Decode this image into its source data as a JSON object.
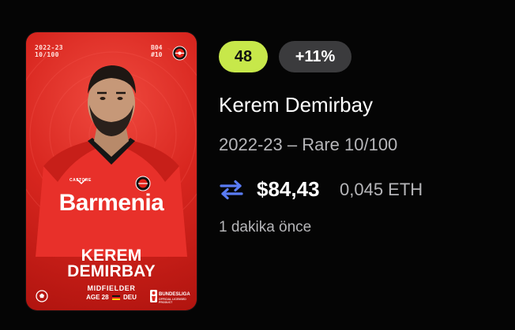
{
  "card": {
    "season_short": "2022-23",
    "serial": "10/100",
    "club_code": "B04",
    "shirt_number": "#10",
    "sponsor": "Barmenia",
    "kit_brand": "CASTORE",
    "name_line1": "KEREM",
    "name_line2": "DEMIRBAY",
    "position": "MIDFIELDER",
    "age_label": "AGE 28",
    "nationality": "DEU",
    "league_name": "BUNDESLIGA",
    "league_sub": "OFFICIAL LICENSED PRODUCT",
    "card_color": "#d8261f"
  },
  "score": "48",
  "delta": "+11%",
  "player_name": "Kerem Demirbay",
  "edition": "2022-23 – Rare 10/100",
  "price_usd": "$84,43",
  "price_eth": "0,045 ETH",
  "timestamp": "1 dakika önce",
  "icons": {
    "swap": "swap-arrows-icon",
    "ball": "football-icon",
    "crest": "club-crest-icon"
  },
  "colors": {
    "score_bg": "#c7e84a",
    "delta_bg": "#3b3b3d",
    "swap_icon": "#5a7cf5",
    "muted_text": "#b6b6b9"
  }
}
